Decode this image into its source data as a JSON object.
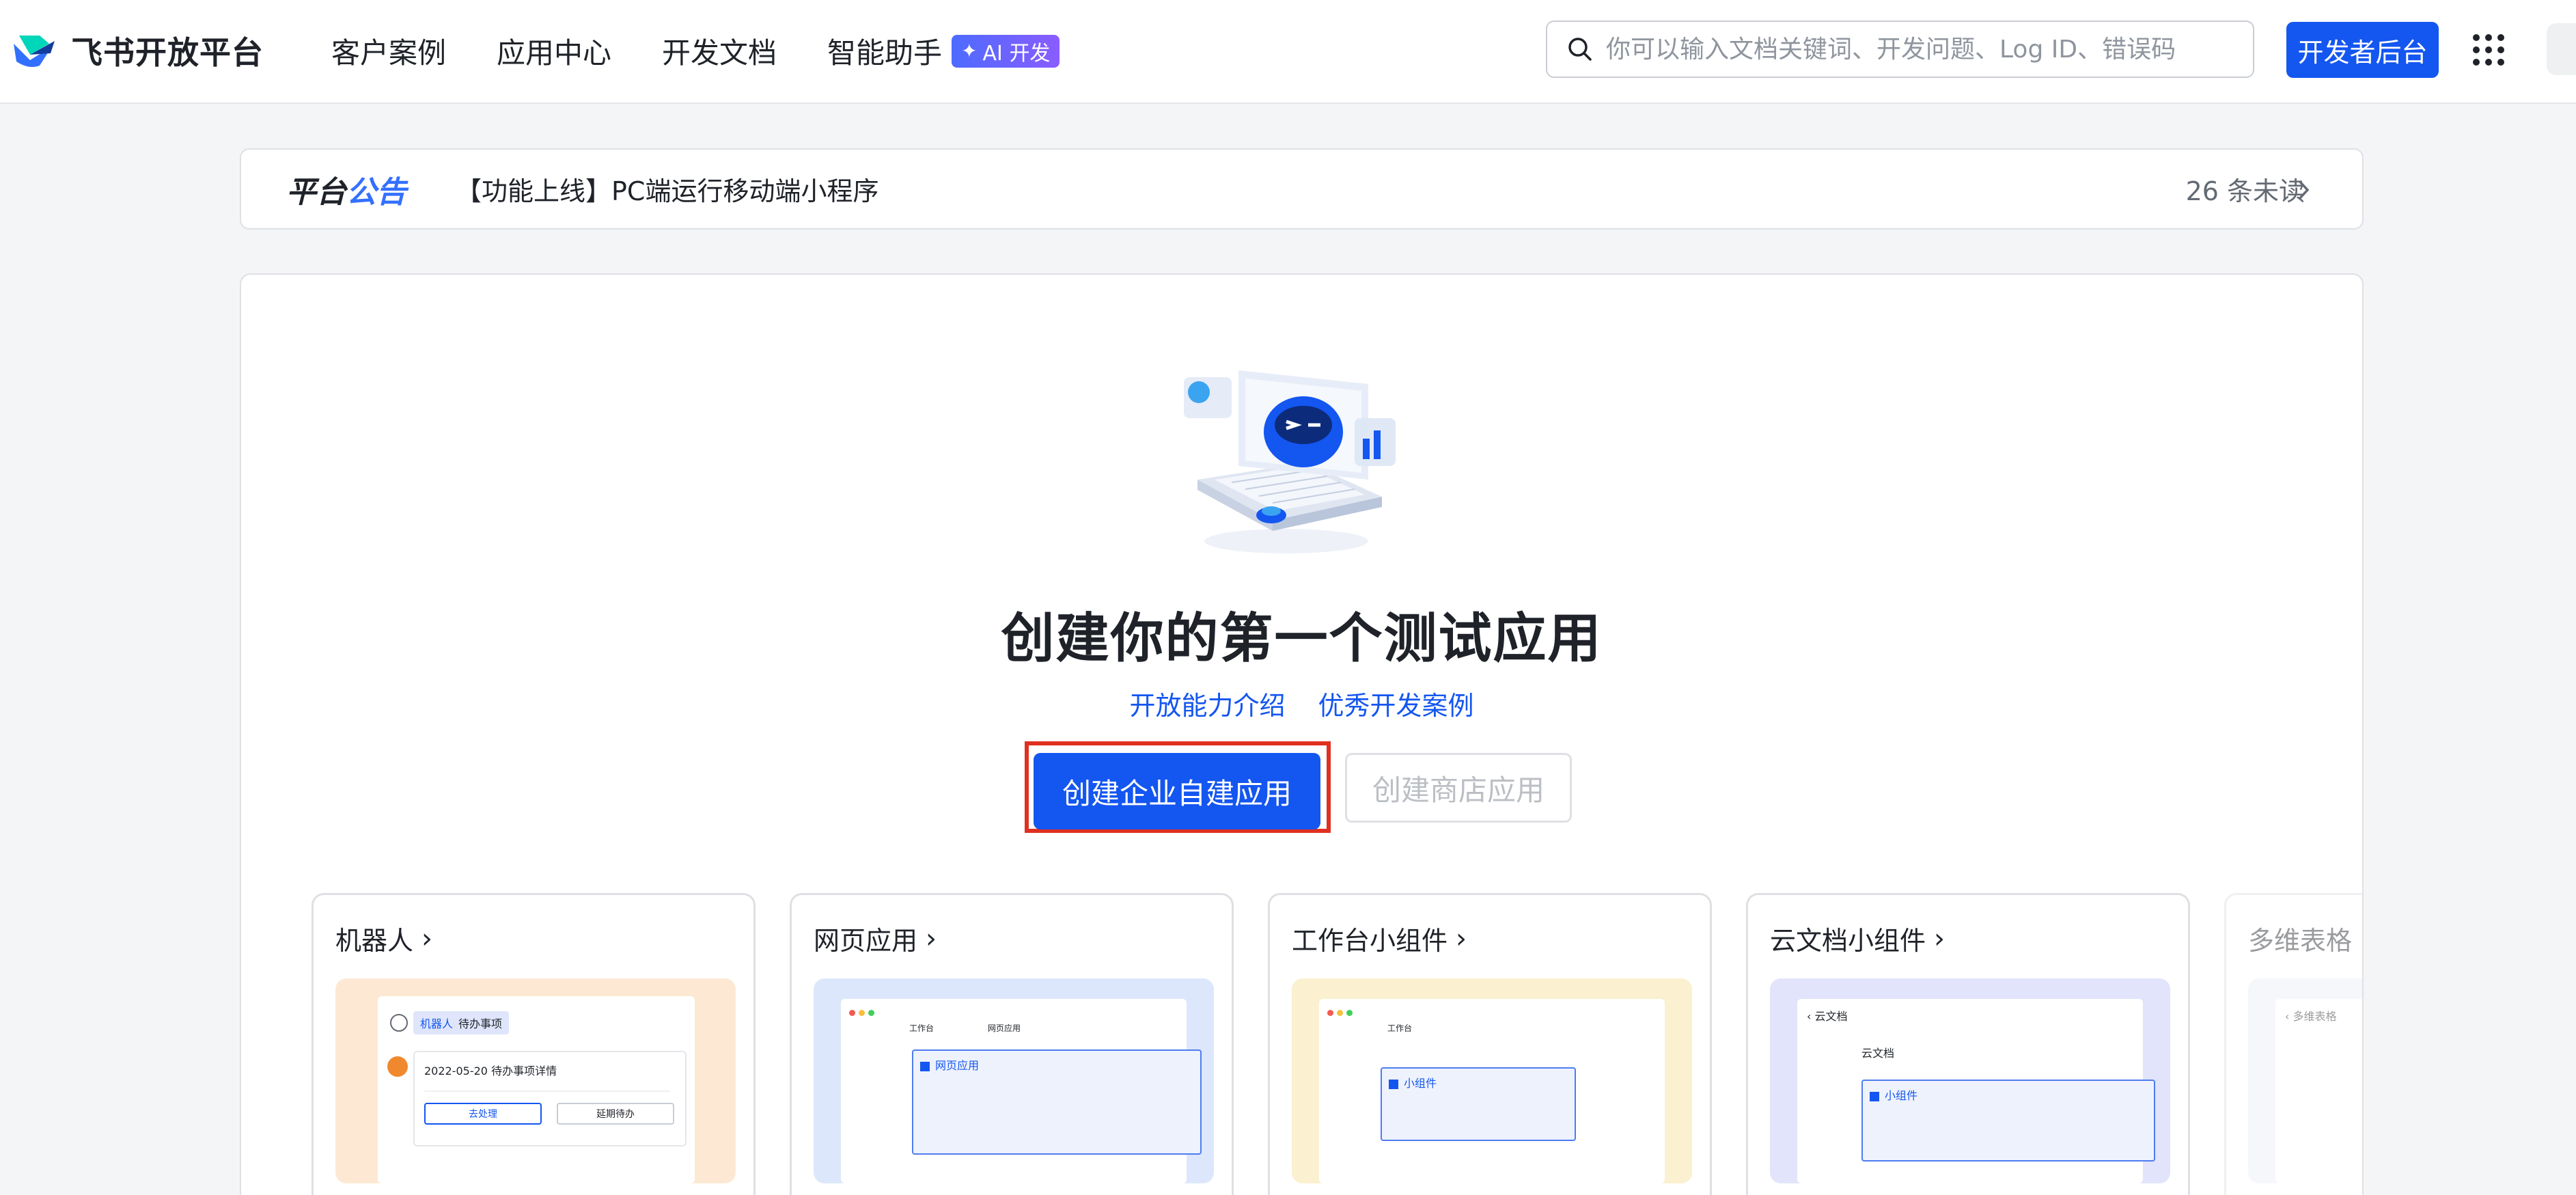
{
  "header": {
    "logo_text": "飞书开放平台",
    "nav": [
      {
        "label": "客户案例"
      },
      {
        "label": "应用中心"
      },
      {
        "label": "开发文档"
      },
      {
        "label": "智能助手"
      }
    ],
    "ai_badge": "AI 开发",
    "search_placeholder": "你可以输入文档关键词、开发问题、Log ID、错误码",
    "dev_console_label": "开发者后台",
    "colors": {
      "brand": "#1456f0",
      "ai_gradient_start": "#4d6bff",
      "ai_gradient_end": "#8a5cff"
    }
  },
  "announcement": {
    "title_part1": "平台",
    "title_part2": "公告",
    "text": "【功能上线】PC端运行移动端小程序",
    "unread": "26 条未读"
  },
  "main": {
    "title": "创建你的第一个测试应用",
    "link_1": "开放能力介绍",
    "link_2": "优秀开发案例",
    "primary_button": "创建企业自建应用",
    "secondary_button": "创建商店应用",
    "highlight_color": "#e03020"
  },
  "cards": [
    {
      "title": "机器人",
      "preview_bg": "#fde9d3"
    },
    {
      "title": "网页应用",
      "preview_bg": "#dde7fb"
    },
    {
      "title": "工作台小组件",
      "preview_bg": "#fbf0cf"
    },
    {
      "title": "云文档小组件",
      "preview_bg": "#e1e4fa"
    },
    {
      "title": "多维表格",
      "preview_bg": "#eceef8"
    }
  ],
  "previews": {
    "bot": {
      "tag": "机器人",
      "tag_title": "待办事项",
      "date_line": "2022-05-20 待办事项详情",
      "btn_1": "去处理",
      "btn_2": "延期待办"
    },
    "web": {
      "tab_1": "工作台",
      "tab_2": "网页应用",
      "box": "网页应用"
    },
    "workbench": {
      "tab_1": "工作台",
      "box": "小组件"
    },
    "docs": {
      "header": "云文档",
      "sub": "云文档",
      "box": "小组件"
    },
    "bitable": {
      "header": "多维表格"
    }
  }
}
